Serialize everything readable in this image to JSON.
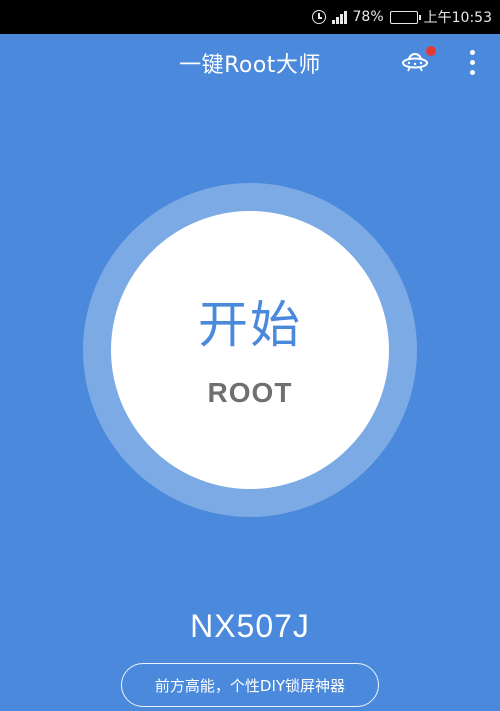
{
  "status_bar": {
    "battery": "78%",
    "time": "上午10:53",
    "icons": [
      "clock-icon",
      "signal-icon",
      "battery-icon"
    ]
  },
  "app_bar": {
    "title": "一键Root大师",
    "ufo_icon": "ufo-icon",
    "more_icon": "more-vertical-icon",
    "notification_dot_color": "#e53935"
  },
  "main": {
    "start_label": "开始",
    "root_label": "ROOT"
  },
  "device": {
    "model": "NX507J"
  },
  "promo": {
    "label": "前方高能，个性DIY锁屏神器"
  },
  "colors": {
    "background": "#4a89dc",
    "accent_text": "#4a89dc"
  }
}
